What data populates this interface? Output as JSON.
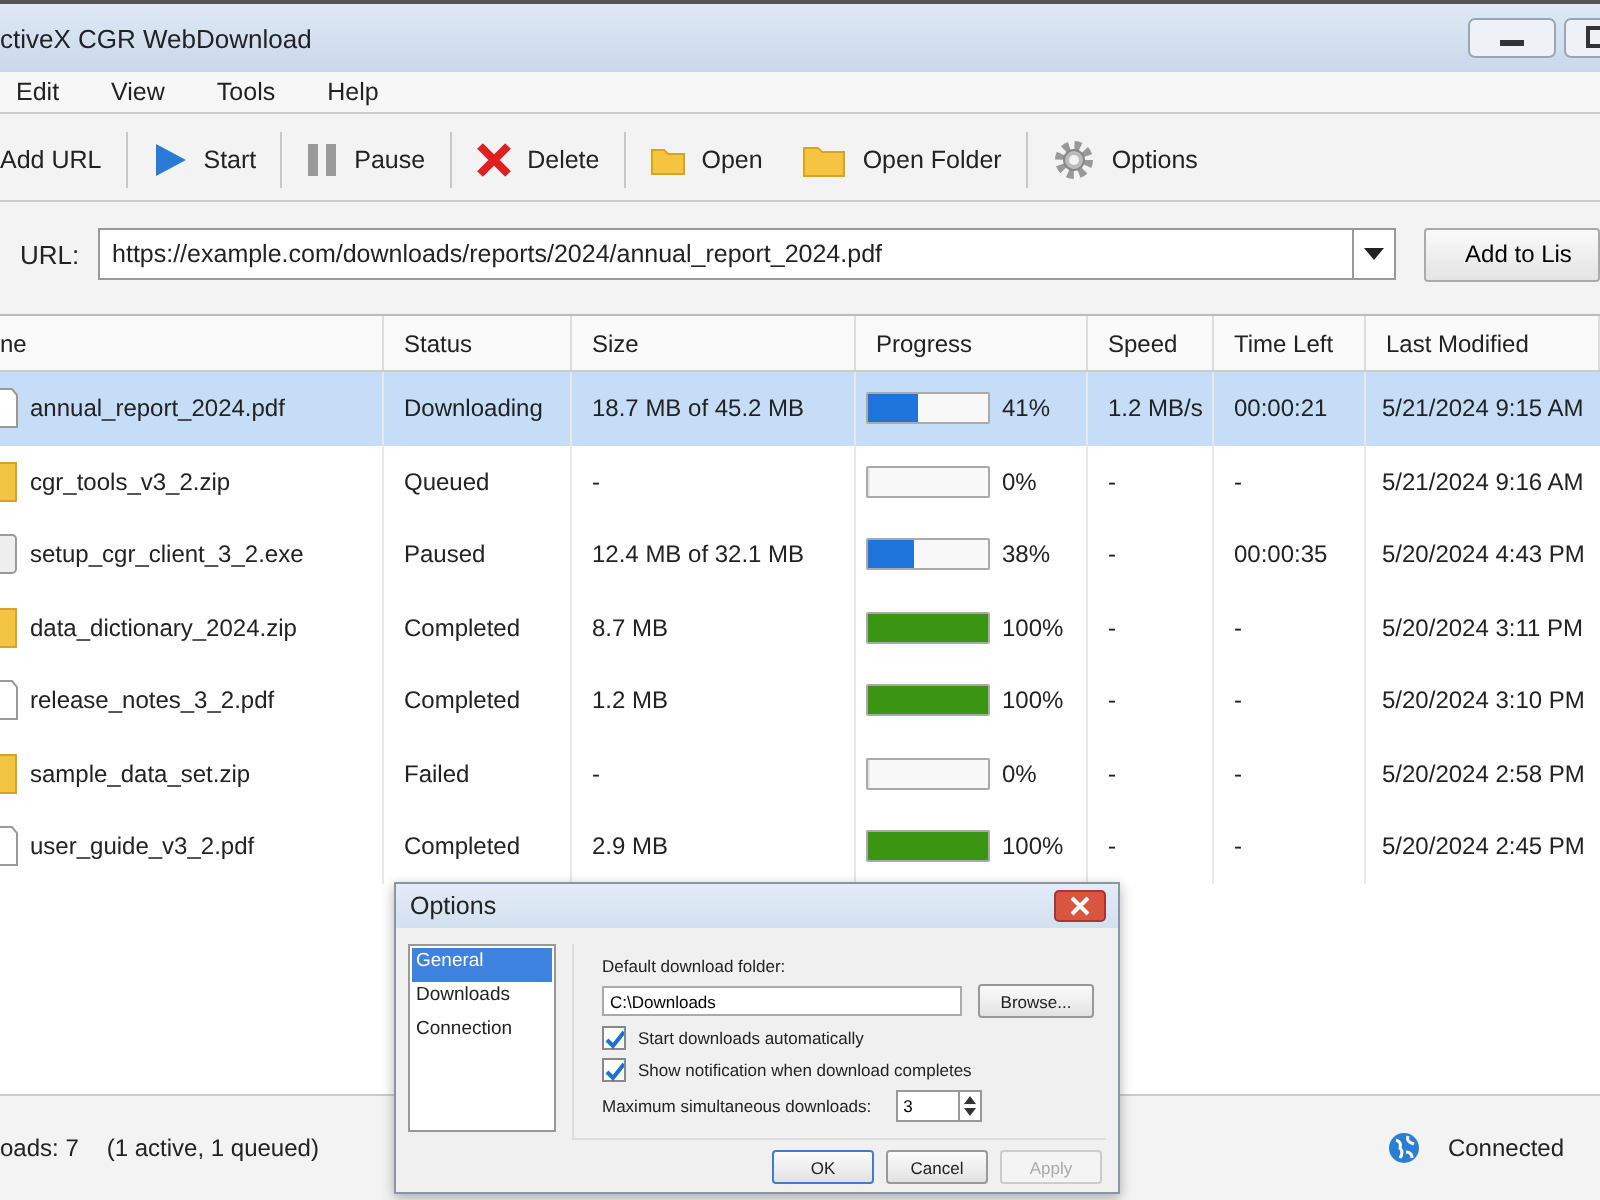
{
  "window": {
    "title": "ctiveX CGR WebDownload"
  },
  "menu": [
    "Edit",
    "View",
    "Tools",
    "Help"
  ],
  "toolbar": [
    {
      "label": "Add URL"
    },
    {
      "label": "Start"
    },
    {
      "label": "Pause"
    },
    {
      "label": "Delete"
    },
    {
      "label": "Open"
    },
    {
      "label": "Open Folder"
    },
    {
      "label": "Options"
    }
  ],
  "url_bar": {
    "label": "URL:",
    "value": "https://example.com/downloads/reports/2024/annual_report_2024.pdf",
    "button": "Add to Lis"
  },
  "table": {
    "columns": [
      "ne",
      "Status",
      "Size",
      "Progress",
      "Speed",
      "Time Left",
      "Last Modified"
    ],
    "rows": [
      {
        "kind": "document",
        "name": "annual_report_2024.pdf",
        "status": "Downloading",
        "size": "18.7 MB of 45.2 MB",
        "level": 0.41,
        "color": "#1f74dc",
        "percent": "41%",
        "speed": "1.2 MB/s",
        "time_left": "00:00:21",
        "modified": "5/21/2024 9:15 AM",
        "selected": true
      },
      {
        "kind": "archive",
        "name": "cgr_tools_v3_2.zip",
        "status": "Queued",
        "size": "-",
        "level": 0,
        "percent": "0%",
        "speed": "-",
        "time_left": "-",
        "modified": "5/21/2024 9:16 AM",
        "selected": false
      },
      {
        "kind": "program",
        "name": "setup_cgr_client_3_2.exe",
        "status": "Paused",
        "size": "12.4 MB of 32.1 MB",
        "level": 0.38,
        "color": "#1f74dc",
        "percent": "38%",
        "speed": "-",
        "time_left": "00:00:35",
        "modified": "5/20/2024 4:43 PM",
        "selected": false
      },
      {
        "kind": "archive",
        "name": "data_dictionary_2024.zip",
        "status": "Completed",
        "size": "8.7 MB",
        "level": 1,
        "color": "#3a9612",
        "percent": "100%",
        "speed": "-",
        "time_left": "-",
        "modified": "5/20/2024 3:11 PM",
        "selected": false
      },
      {
        "kind": "document",
        "name": "release_notes_3_2.pdf",
        "status": "Completed",
        "size": "1.2 MB",
        "level": 1,
        "color": "#3a9612",
        "percent": "100%",
        "speed": "-",
        "time_left": "-",
        "modified": "5/20/2024 3:10 PM",
        "selected": false
      },
      {
        "kind": "archive",
        "name": "sample_data_set.zip",
        "status": "Failed",
        "size": "-",
        "level": 0,
        "percent": "0%",
        "speed": "-",
        "time_left": "-",
        "modified": "5/20/2024 2:58 PM",
        "selected": false
      },
      {
        "kind": "document",
        "name": "user_guide_v3_2.pdf",
        "status": "Completed",
        "size": "2.9 MB",
        "level": 1,
        "color": "#3a9612",
        "percent": "100%",
        "speed": "-",
        "time_left": "-",
        "modified": "5/20/2024 2:45 PM",
        "selected": false
      }
    ]
  },
  "status_bar": {
    "count": "oads: 7",
    "detail": "(1 active, 1 queued)",
    "connection": "Connected"
  },
  "dialog": {
    "title": "Options",
    "categories": [
      {
        "label": "General",
        "selected": true
      },
      {
        "label": "Downloads",
        "selected": false
      },
      {
        "label": "Connection",
        "selected": false
      }
    ],
    "folder_label": "Default download folder:",
    "folder_value": "C:\\Downloads",
    "browse": "Browse...",
    "options": [
      {
        "label": "Start downloads automatically",
        "checked": true
      },
      {
        "label": "Show notification when download completes",
        "checked": true
      }
    ],
    "max_label": "Maximum simultaneous downloads:",
    "max_value": "3",
    "buttons": [
      {
        "label": "OK",
        "disabled": false
      },
      {
        "label": "Cancel",
        "disabled": false
      },
      {
        "label": "Apply",
        "disabled": true
      }
    ]
  }
}
